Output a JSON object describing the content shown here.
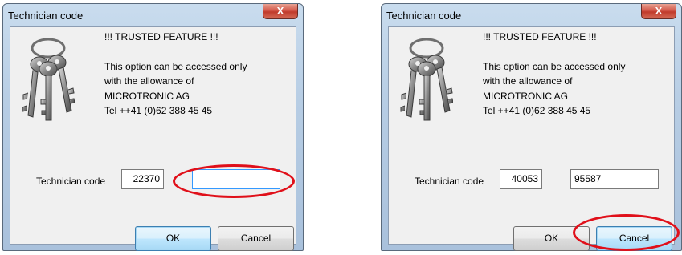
{
  "dialogs": [
    {
      "title": "Technician code",
      "close_label": "X",
      "message": {
        "heading": "!!! TRUSTED FEATURE !!!",
        "line1": "This option can be accessed  only",
        "line2": "with the allowance of",
        "line3": "MICROTRONIC AG",
        "line4": "Tel ++41 (0)62 388 45 45"
      },
      "code_label": "Technician code",
      "code_value": "22370",
      "response_value": "",
      "ok_label": "OK",
      "cancel_label": "Cancel"
    },
    {
      "title": "Technician code",
      "close_label": "X",
      "message": {
        "heading": "!!! TRUSTED FEATURE !!!",
        "line1": "This option can be accessed  only",
        "line2": "with the allowance of",
        "line3": "MICROTRONIC AG",
        "line4": "Tel ++41 (0)62 388 45 45"
      },
      "code_label": "Technician code",
      "code_value": "40053",
      "response_value": "95587",
      "ok_label": "OK",
      "cancel_label": "Cancel"
    }
  ],
  "colors": {
    "annotation_circle": "#e0101a",
    "close_button": "#c9463a",
    "window_frame": "#b7cde4",
    "focus_border": "#3399ff"
  },
  "icons": {
    "close": "close-icon",
    "keys": "keys-icon"
  }
}
